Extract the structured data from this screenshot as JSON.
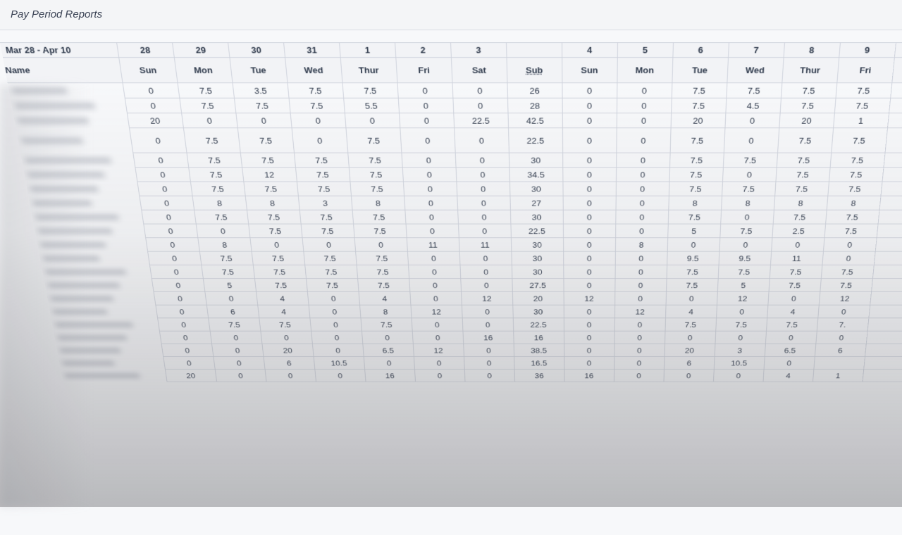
{
  "header": {
    "title": "Pay Period Reports"
  },
  "table": {
    "range_label": "Mar 28 - Apr 10",
    "name_header": "Name",
    "dates": [
      "28",
      "29",
      "30",
      "31",
      "1",
      "2",
      "3",
      "",
      "4",
      "5",
      "6",
      "7",
      "8",
      "9",
      ""
    ],
    "days": [
      "Sun",
      "Mon",
      "Tue",
      "Wed",
      "Thur",
      "Fri",
      "Sat",
      "Sub",
      "Sun",
      "Mon",
      "Tue",
      "Wed",
      "Thur",
      "Fri",
      ""
    ],
    "rows": [
      [
        "0",
        "7.5",
        "3.5",
        "7.5",
        "7.5",
        "0",
        "0",
        "26",
        "0",
        "0",
        "7.5",
        "7.5",
        "7.5",
        "7.5",
        ""
      ],
      [
        "0",
        "7.5",
        "7.5",
        "7.5",
        "5.5",
        "0",
        "0",
        "28",
        "0",
        "0",
        "7.5",
        "4.5",
        "7.5",
        "7.5",
        ""
      ],
      [
        "20",
        "0",
        "0",
        "0",
        "0",
        "0",
        "22.5",
        "42.5",
        "0",
        "0",
        "20",
        "0",
        "20",
        "1",
        ""
      ],
      [
        "0",
        "7.5",
        "7.5",
        "0",
        "7.5",
        "0",
        "0",
        "22.5",
        "0",
        "0",
        "7.5",
        "0",
        "7.5",
        "7.5",
        ""
      ],
      [
        "0",
        "7.5",
        "7.5",
        "7.5",
        "7.5",
        "0",
        "0",
        "30",
        "0",
        "0",
        "7.5",
        "7.5",
        "7.5",
        "7.5",
        ""
      ],
      [
        "0",
        "7.5",
        "12",
        "7.5",
        "7.5",
        "0",
        "0",
        "34.5",
        "0",
        "0",
        "7.5",
        "0",
        "7.5",
        "7.5",
        ""
      ],
      [
        "0",
        "7.5",
        "7.5",
        "7.5",
        "7.5",
        "0",
        "0",
        "30",
        "0",
        "0",
        "7.5",
        "7.5",
        "7.5",
        "7.5",
        ""
      ],
      [
        "0",
        "8",
        "8",
        "3",
        "8",
        "0",
        "0",
        "27",
        "0",
        "0",
        "8",
        "8",
        "8",
        "8",
        ""
      ],
      [
        "0",
        "7.5",
        "7.5",
        "7.5",
        "7.5",
        "0",
        "0",
        "30",
        "0",
        "0",
        "7.5",
        "0",
        "7.5",
        "7.5",
        ""
      ],
      [
        "0",
        "0",
        "7.5",
        "7.5",
        "7.5",
        "0",
        "0",
        "22.5",
        "0",
        "0",
        "5",
        "7.5",
        "2.5",
        "7.5",
        ""
      ],
      [
        "0",
        "8",
        "0",
        "0",
        "0",
        "11",
        "11",
        "30",
        "0",
        "8",
        "0",
        "0",
        "0",
        "0",
        ""
      ],
      [
        "0",
        "7.5",
        "7.5",
        "7.5",
        "7.5",
        "0",
        "0",
        "30",
        "0",
        "0",
        "9.5",
        "9.5",
        "11",
        "0",
        ""
      ],
      [
        "0",
        "7.5",
        "7.5",
        "7.5",
        "7.5",
        "0",
        "0",
        "30",
        "0",
        "0",
        "7.5",
        "7.5",
        "7.5",
        "7.5",
        ""
      ],
      [
        "0",
        "5",
        "7.5",
        "7.5",
        "7.5",
        "0",
        "0",
        "27.5",
        "0",
        "0",
        "7.5",
        "5",
        "7.5",
        "7.5",
        ""
      ],
      [
        "0",
        "0",
        "4",
        "0",
        "4",
        "0",
        "12",
        "20",
        "12",
        "0",
        "0",
        "12",
        "0",
        "12",
        ""
      ],
      [
        "0",
        "6",
        "4",
        "0",
        "8",
        "12",
        "0",
        "30",
        "0",
        "12",
        "4",
        "0",
        "4",
        "0",
        ""
      ],
      [
        "0",
        "7.5",
        "7.5",
        "0",
        "7.5",
        "0",
        "0",
        "22.5",
        "0",
        "0",
        "7.5",
        "7.5",
        "7.5",
        "7.",
        ""
      ],
      [
        "0",
        "0",
        "0",
        "0",
        "0",
        "0",
        "16",
        "16",
        "0",
        "0",
        "0",
        "0",
        "0",
        "0",
        ""
      ],
      [
        "0",
        "0",
        "20",
        "0",
        "6.5",
        "12",
        "0",
        "38.5",
        "0",
        "0",
        "20",
        "3",
        "6.5",
        "6",
        ""
      ],
      [
        "0",
        "0",
        "6",
        "10.5",
        "0",
        "0",
        "0",
        "16.5",
        "0",
        "0",
        "6",
        "10.5",
        "0",
        "",
        ""
      ],
      [
        "20",
        "0",
        "0",
        "0",
        "16",
        "0",
        "0",
        "36",
        "16",
        "0",
        "0",
        "0",
        "4",
        "1",
        ""
      ]
    ],
    "tall_rows": [
      3
    ]
  }
}
